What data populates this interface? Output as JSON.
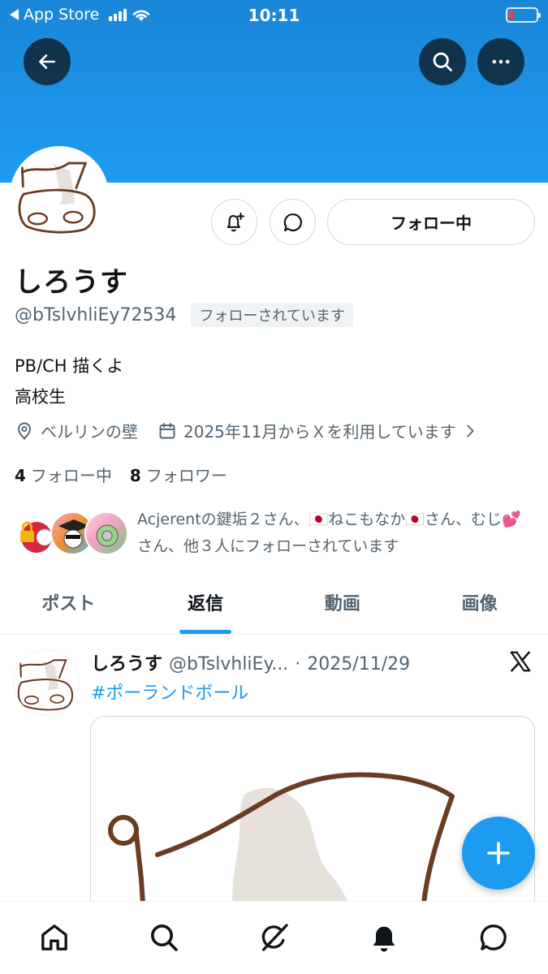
{
  "status_bar": {
    "back_app": "App Store",
    "time": "10:11"
  },
  "profile": {
    "name": "しろうす",
    "handle": "@bTslvhliEy72534",
    "follows_you": "フォローされています",
    "follow_button": "フォロー中",
    "bio_line1": "PB/CH 描くよ",
    "bio_line2": "高校生",
    "location": "ベルリンの壁",
    "joined": "2025年11月からＸを利用しています",
    "following_count": "4",
    "following_label": "フォロー中",
    "followers_count": "8",
    "followers_label": "フォロワー",
    "known_followers_text": "Acjerentの鍵垢２さん、🇯🇵ねこもなか🇯🇵さん、むじ💕さん、他３人にフォローされています"
  },
  "tabs": [
    {
      "label": "ポスト",
      "active": false
    },
    {
      "label": "返信",
      "active": true
    },
    {
      "label": "動画",
      "active": false
    },
    {
      "label": "画像",
      "active": false
    }
  ],
  "post": {
    "author_name": "しろうす",
    "author_handle": "@bTslvhliEy...",
    "separator": "·",
    "date": "2025/11/29",
    "hashtag": "#ポーランドボール"
  },
  "icons": {
    "back": "arrow-left-icon",
    "search": "search-icon",
    "more": "more-horizontal-icon",
    "notify": "bell-plus-icon",
    "message": "message-bubble-icon",
    "location": "location-pin-icon",
    "calendar": "calendar-icon",
    "compose": "plus-icon",
    "nav": [
      "home-icon",
      "search-icon",
      "grok-icon",
      "bell-icon",
      "messages-icon"
    ]
  },
  "colors": {
    "accent": "#1d9bf0",
    "banner": "#1d9bf0",
    "text_secondary": "#536471"
  }
}
